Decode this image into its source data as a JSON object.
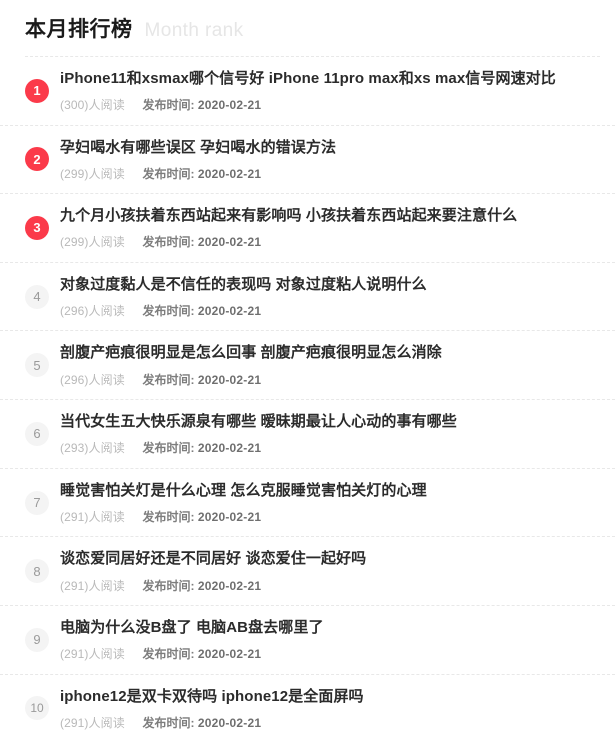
{
  "header": {
    "title": "本月排行榜",
    "subtitle": "Month rank"
  },
  "meta_labels": {
    "views_suffix": "人阅读",
    "date_label": "发布时间:"
  },
  "theme": {
    "accent": "#fb3a4a",
    "badge_bg": "#f4f4f4",
    "badge_text": "#9a9a9a",
    "title_text": "#2b2b2b",
    "subtitle_text": "#e6e6e6",
    "divider": "#e8e8e8",
    "background": "#ffffff"
  },
  "list": [
    {
      "rank": "1",
      "highlight": true,
      "title": "iPhone11和xsmax哪个信号好 iPhone 11pro max和xs max信号网速对比",
      "views": "(300)人阅读",
      "date_label": "发布时间:",
      "date": "2020-02-21"
    },
    {
      "rank": "2",
      "highlight": true,
      "title": "孕妇喝水有哪些误区 孕妇喝水的错误方法",
      "views": "(299)人阅读",
      "date_label": "发布时间:",
      "date": "2020-02-21"
    },
    {
      "rank": "3",
      "highlight": true,
      "title": "九个月小孩扶着东西站起来有影响吗 小孩扶着东西站起来要注意什么",
      "views": "(299)人阅读",
      "date_label": "发布时间:",
      "date": "2020-02-21"
    },
    {
      "rank": "4",
      "highlight": false,
      "title": "对象过度黏人是不信任的表现吗 对象过度粘人说明什么",
      "views": "(296)人阅读",
      "date_label": "发布时间:",
      "date": "2020-02-21"
    },
    {
      "rank": "5",
      "highlight": false,
      "title": "剖腹产疤痕很明显是怎么回事 剖腹产疤痕很明显怎么消除",
      "views": "(296)人阅读",
      "date_label": "发布时间:",
      "date": "2020-02-21"
    },
    {
      "rank": "6",
      "highlight": false,
      "title": "当代女生五大快乐源泉有哪些 暧昧期最让人心动的事有哪些",
      "views": "(293)人阅读",
      "date_label": "发布时间:",
      "date": "2020-02-21"
    },
    {
      "rank": "7",
      "highlight": false,
      "title": "睡觉害怕关灯是什么心理 怎么克服睡觉害怕关灯的心理",
      "views": "(291)人阅读",
      "date_label": "发布时间:",
      "date": "2020-02-21"
    },
    {
      "rank": "8",
      "highlight": false,
      "title": "谈恋爱同居好还是不同居好 谈恋爱住一起好吗",
      "views": "(291)人阅读",
      "date_label": "发布时间:",
      "date": "2020-02-21"
    },
    {
      "rank": "9",
      "highlight": false,
      "title": "电脑为什么没B盘了 电脑AB盘去哪里了",
      "views": "(291)人阅读",
      "date_label": "发布时间:",
      "date": "2020-02-21"
    },
    {
      "rank": "10",
      "highlight": false,
      "title": "iphone12是双卡双待吗 iphone12是全面屏吗",
      "views": "(291)人阅读",
      "date_label": "发布时间:",
      "date": "2020-02-21"
    }
  ]
}
